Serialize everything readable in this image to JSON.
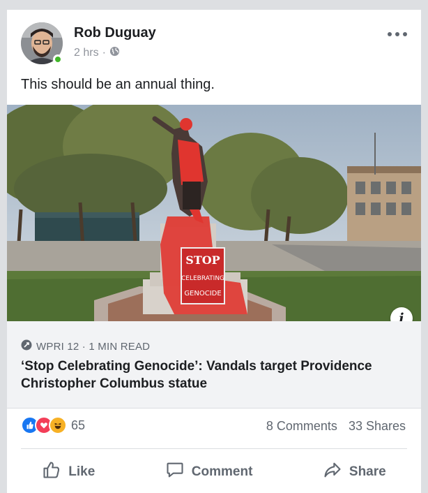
{
  "post": {
    "author": "Rob Duguay",
    "time": "2 hrs",
    "separator": "·",
    "caption": "This should be an annual thing."
  },
  "photo": {
    "sign_lines": [
      "STOP",
      "CELEBRATING",
      "GENOCIDE"
    ]
  },
  "link": {
    "source": "WPRI 12 · 1 MIN READ",
    "headline": "‘Stop Celebrating Genocide’: Vandals target Providence Christopher Columbus statue"
  },
  "engagement": {
    "reaction_count": "65",
    "comments": "8 Comments",
    "shares": "33 Shares"
  },
  "actions": {
    "like": "Like",
    "comment": "Comment",
    "share": "Share"
  },
  "colors": {
    "online": "#42b72a",
    "like_blue": "#1877f2",
    "love_red": "#f33e58",
    "haha_yellow": "#f7b125",
    "paint_red": "#e0352f"
  },
  "icons": [
    "globe-icon",
    "more-icon",
    "info-icon",
    "link-icon",
    "like-icon",
    "comment-icon",
    "share-icon"
  ]
}
